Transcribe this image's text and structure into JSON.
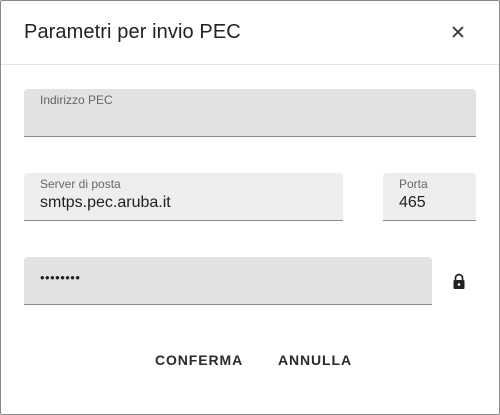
{
  "dialog": {
    "title": "Parametri per invio PEC",
    "close_icon": "close-icon"
  },
  "fields": {
    "pec_address": {
      "label": "Indirizzo PEC",
      "value": ""
    },
    "mail_server": {
      "label": "Server di posta",
      "value": "smtps.pec.aruba.it"
    },
    "port": {
      "label": "Porta",
      "value": "465"
    },
    "password": {
      "value": "••••••••",
      "icon": "lock-icon"
    }
  },
  "actions": {
    "confirm_label": "CONFERMA",
    "cancel_label": "ANNULLA"
  }
}
